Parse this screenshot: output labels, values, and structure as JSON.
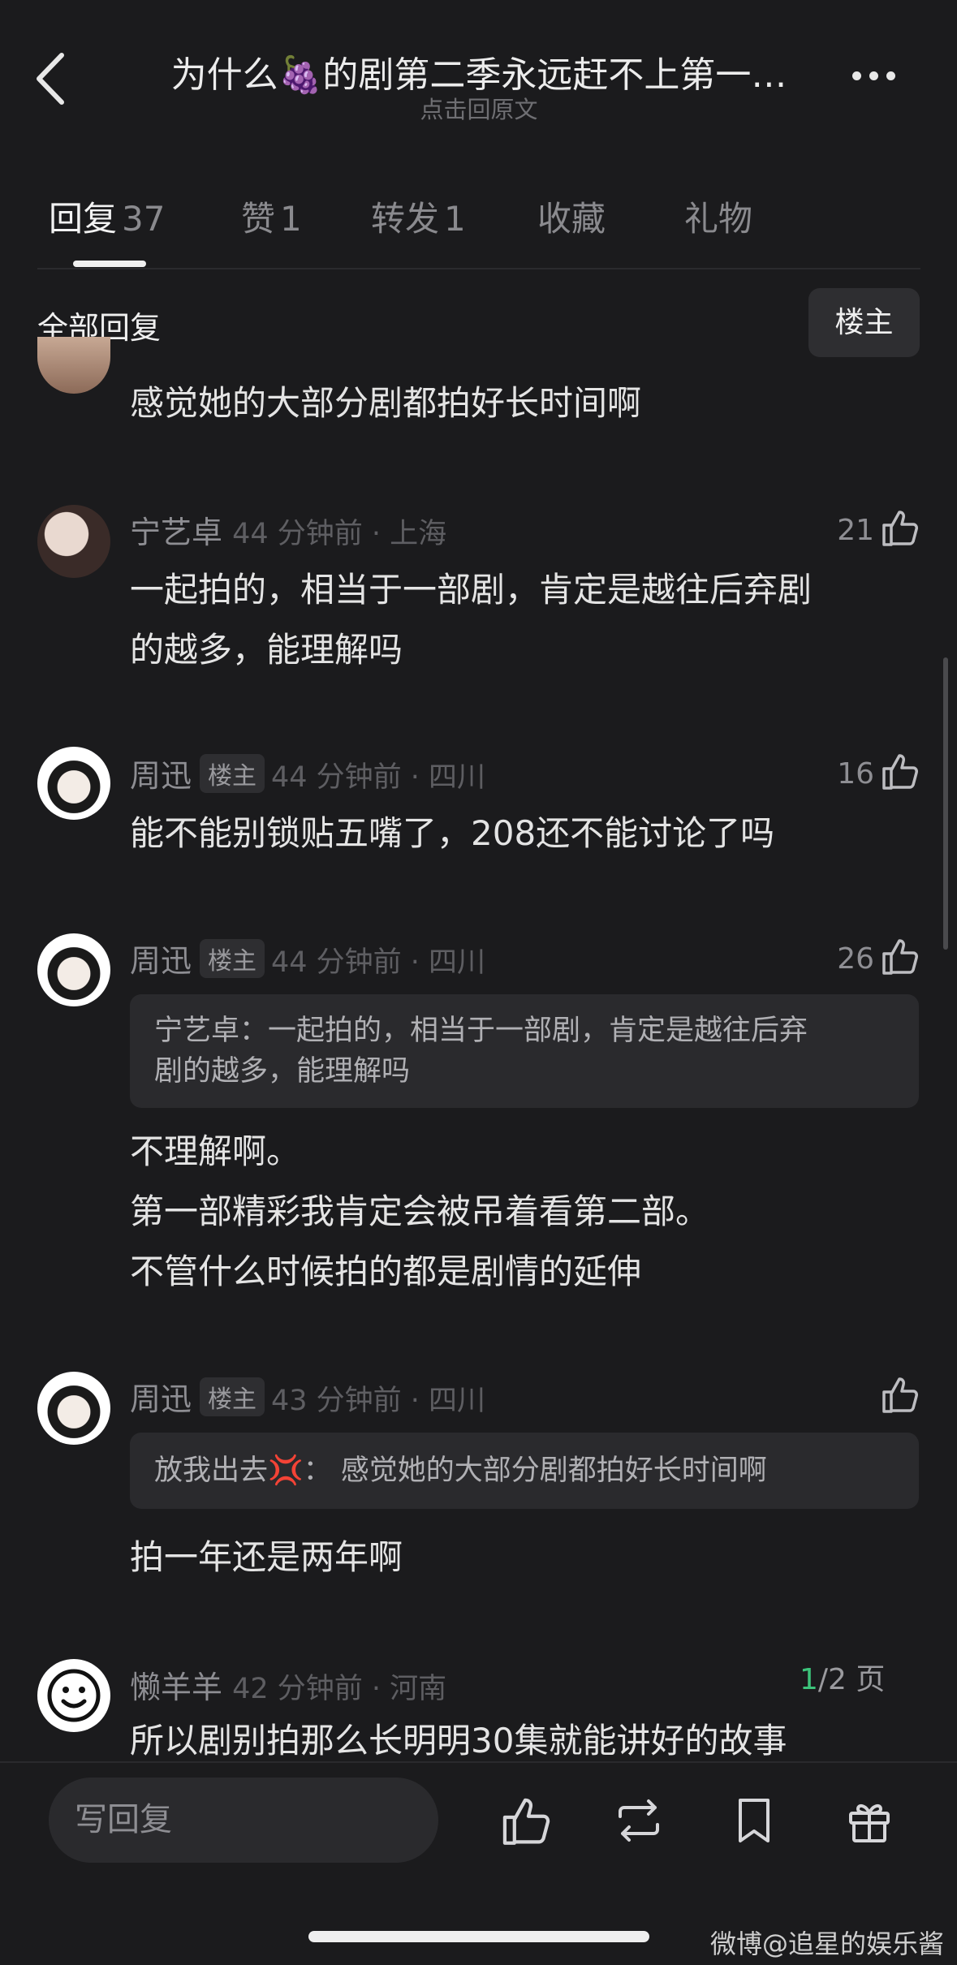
{
  "header": {
    "title": "为什么🍇的剧第二季永远赶不上第一…",
    "subtitle": "点击回原文"
  },
  "tabs": [
    {
      "label": "回复",
      "count": "37"
    },
    {
      "label": "赞",
      "count": "1"
    },
    {
      "label": "转发",
      "count": "1"
    },
    {
      "label": "收藏",
      "count": ""
    },
    {
      "label": "礼物",
      "count": ""
    }
  ],
  "section": {
    "label": "全部回复",
    "filter_button": "楼主"
  },
  "comments": [
    {
      "body": "感觉她的大部分剧都拍好长时间啊"
    },
    {
      "name": "宁艺卓",
      "badge": "",
      "meta": "44 分钟前 · 上海",
      "likes": "21",
      "quote": "",
      "body": "一起拍的，相当于一部剧，肯定是越往后弃剧\n的越多，能理解吗"
    },
    {
      "name": "周迅",
      "badge": "楼主",
      "meta": "44 分钟前 · 四川",
      "likes": "16",
      "quote": "",
      "body": "能不能别锁贴五嘴了，208还不能讨论了吗"
    },
    {
      "name": "周迅",
      "badge": "楼主",
      "meta": "44 分钟前 · 四川",
      "likes": "26",
      "quote": "宁艺卓：一起拍的，相当于一部剧，肯定是越往后弃\n剧的越多，能理解吗",
      "body": "不理解啊。\n第一部精彩我肯定会被吊着看第二部。\n不管什么时候拍的都是剧情的延伸"
    },
    {
      "name": "周迅",
      "badge": "楼主",
      "meta": "43 分钟前 · 四川",
      "likes": "",
      "quote": "放我出去💢：  感觉她的大部分剧都拍好长时间啊",
      "body": "拍一年还是两年啊"
    },
    {
      "name": "懒羊羊",
      "badge": "",
      "meta": "42 分钟前 · 河南",
      "likes": "",
      "quote": "",
      "body": "所以剧别拍那么长明明30集就能讲好的故事"
    }
  ],
  "pager": {
    "current": "1",
    "total": "/2 页"
  },
  "bottom": {
    "reply_placeholder": "写回复"
  },
  "watermark": "微博@追星的娱乐酱",
  "colors": {
    "background": "#1b1b1d",
    "accent_green": "#3cc37a"
  }
}
